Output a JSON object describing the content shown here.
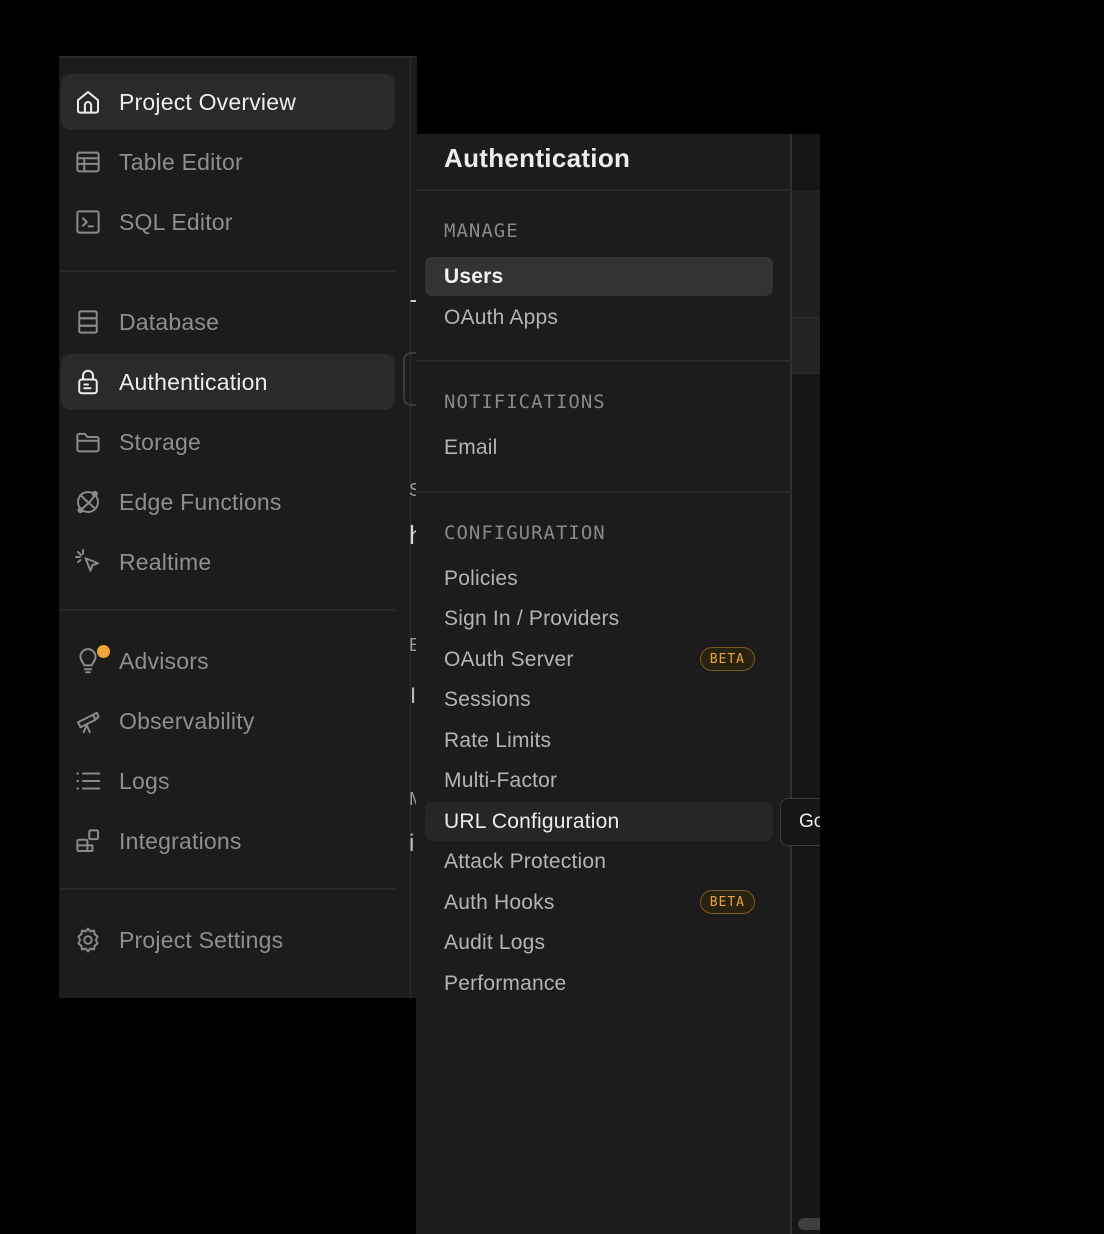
{
  "nav": {
    "items": [
      {
        "label": "Project Overview",
        "icon": "home-icon",
        "active": true
      },
      {
        "label": "Table Editor",
        "icon": "table-icon"
      },
      {
        "label": "SQL Editor",
        "icon": "terminal-icon"
      },
      {
        "label": "Database",
        "icon": "database-icon"
      },
      {
        "label": "Authentication",
        "icon": "lock-icon",
        "active": true
      },
      {
        "label": "Storage",
        "icon": "folder-icon"
      },
      {
        "label": "Edge Functions",
        "icon": "globe-icon"
      },
      {
        "label": "Realtime",
        "icon": "cursor-click-icon"
      },
      {
        "label": "Advisors",
        "icon": "lightbulb-icon",
        "notification_color": "#f0a43a"
      },
      {
        "label": "Observability",
        "icon": "telescope-icon"
      },
      {
        "label": "Logs",
        "icon": "list-icon"
      },
      {
        "label": "Integrations",
        "icon": "blocks-icon"
      },
      {
        "label": "Project Settings",
        "icon": "gear-icon"
      }
    ]
  },
  "peek": {
    "chars": [
      "T",
      "S",
      "h",
      "E",
      "I",
      "M",
      "i"
    ]
  },
  "auth": {
    "title": "Authentication",
    "sections": [
      {
        "heading": "MANAGE",
        "items": [
          {
            "label": "Users",
            "selected": true
          },
          {
            "label": "OAuth Apps"
          }
        ]
      },
      {
        "heading": "NOTIFICATIONS",
        "items": [
          {
            "label": "Email"
          }
        ]
      },
      {
        "heading": "CONFIGURATION",
        "items": [
          {
            "label": "Policies"
          },
          {
            "label": "Sign In / Providers"
          },
          {
            "label": "OAuth Server",
            "badge": "BETA"
          },
          {
            "label": "Sessions"
          },
          {
            "label": "Rate Limits"
          },
          {
            "label": "Multi-Factor"
          },
          {
            "label": "URL Configuration",
            "hovered": true
          },
          {
            "label": "Attack Protection"
          },
          {
            "label": "Auth Hooks",
            "badge": "BETA"
          },
          {
            "label": "Audit Logs"
          },
          {
            "label": "Performance"
          }
        ]
      }
    ]
  },
  "tooltip": {
    "text": "Go"
  },
  "colors": {
    "accent_warning": "#e7a33e",
    "background": "#1c1c1c"
  }
}
